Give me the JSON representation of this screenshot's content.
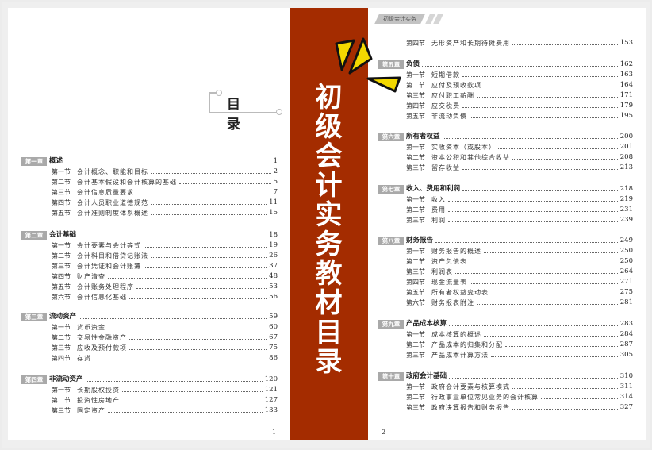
{
  "banner": {
    "chars": [
      "初",
      "级",
      "会",
      "计",
      "实",
      "务",
      "教",
      "材",
      "目",
      "录"
    ],
    "text": "初级会计实务教材目录",
    "color": "#a42c00"
  },
  "left_page": {
    "title": "目 录",
    "page_number": "1",
    "chapters": [
      {
        "badge": "第一章",
        "title": "概述",
        "page": "1",
        "sections": [
          {
            "label": "第一节",
            "title": "会计概念、职能和目标",
            "page": "2"
          },
          {
            "label": "第二节",
            "title": "会计基本假设和会计核算的基础",
            "page": "5"
          },
          {
            "label": "第三节",
            "title": "会计信息质量要求",
            "page": "7"
          },
          {
            "label": "第四节",
            "title": "会计人员职业道德规范",
            "page": "11"
          },
          {
            "label": "第五节",
            "title": "会计准则制度体系概述",
            "page": "15"
          }
        ]
      },
      {
        "badge": "第二章",
        "title": "会计基础",
        "page": "18",
        "sections": [
          {
            "label": "第一节",
            "title": "会计要素与会计等式",
            "page": "19"
          },
          {
            "label": "第二节",
            "title": "会计科目和借贷记账法",
            "page": "26"
          },
          {
            "label": "第三节",
            "title": "会计凭证和会计账簿",
            "page": "37"
          },
          {
            "label": "第四节",
            "title": "财产清查",
            "page": "48"
          },
          {
            "label": "第五节",
            "title": "会计账务处理程序",
            "page": "53"
          },
          {
            "label": "第六节",
            "title": "会计信息化基础",
            "page": "56"
          }
        ]
      },
      {
        "badge": "第三章",
        "title": "流动资产",
        "page": "59",
        "sections": [
          {
            "label": "第一节",
            "title": "货币资金",
            "page": "60"
          },
          {
            "label": "第二节",
            "title": "交易性金融资产",
            "page": "67"
          },
          {
            "label": "第三节",
            "title": "应收及预付款项",
            "page": "75"
          },
          {
            "label": "第四节",
            "title": "存货",
            "page": "86"
          }
        ]
      },
      {
        "badge": "第四章",
        "title": "非流动资产",
        "page": "120",
        "sections": [
          {
            "label": "第一节",
            "title": "长期股权投资",
            "page": "121"
          },
          {
            "label": "第二节",
            "title": "投资性房地产",
            "page": "127"
          },
          {
            "label": "第三节",
            "title": "固定资产",
            "page": "133"
          }
        ]
      }
    ]
  },
  "right_page": {
    "header": "初级会计实务",
    "page_number": "2",
    "continued_section": {
      "label": "第四节",
      "title": "无形资产和长期待摊费用",
      "page": "153"
    },
    "chapters": [
      {
        "badge": "第五章",
        "title": "负债",
        "page": "162",
        "sections": [
          {
            "label": "第一节",
            "title": "短期借款",
            "page": "163"
          },
          {
            "label": "第二节",
            "title": "应付及预收款项",
            "page": "164"
          },
          {
            "label": "第三节",
            "title": "应付职工薪酬",
            "page": "171"
          },
          {
            "label": "第四节",
            "title": "应交税费",
            "page": "179"
          },
          {
            "label": "第五节",
            "title": "非流动负债",
            "page": "195"
          }
        ]
      },
      {
        "badge": "第六章",
        "title": "所有者权益",
        "page": "200",
        "sections": [
          {
            "label": "第一节",
            "title": "实收资本（或股本）",
            "page": "201"
          },
          {
            "label": "第二节",
            "title": "资本公积和其他综合收益",
            "page": "208"
          },
          {
            "label": "第三节",
            "title": "留存收益",
            "page": "213"
          }
        ]
      },
      {
        "badge": "第七章",
        "title": "收入、费用和利润",
        "page": "218",
        "sections": [
          {
            "label": "第一节",
            "title": "收入",
            "page": "219"
          },
          {
            "label": "第二节",
            "title": "费用",
            "page": "231"
          },
          {
            "label": "第三节",
            "title": "利润",
            "page": "239"
          }
        ]
      },
      {
        "badge": "第八章",
        "title": "财务报告",
        "page": "249",
        "sections": [
          {
            "label": "第一节",
            "title": "财务报告的概述",
            "page": "250"
          },
          {
            "label": "第二节",
            "title": "资产负债表",
            "page": "250"
          },
          {
            "label": "第三节",
            "title": "利润表",
            "page": "264"
          },
          {
            "label": "第四节",
            "title": "现金流量表",
            "page": "271"
          },
          {
            "label": "第五节",
            "title": "所有者权益变动表",
            "page": "275"
          },
          {
            "label": "第六节",
            "title": "财务报表附注",
            "page": "281"
          }
        ]
      },
      {
        "badge": "第九章",
        "title": "产品成本核算",
        "page": "283",
        "sections": [
          {
            "label": "第一节",
            "title": "成本核算的概述",
            "page": "284"
          },
          {
            "label": "第二节",
            "title": "产品成本的归集和分配",
            "page": "287"
          },
          {
            "label": "第三节",
            "title": "产品成本计算方法",
            "page": "305"
          }
        ]
      },
      {
        "badge": "第十章",
        "title": "政府会计基础",
        "page": "310",
        "sections": [
          {
            "label": "第一节",
            "title": "政府会计要素与核算模式",
            "page": "311"
          },
          {
            "label": "第二节",
            "title": "行政事业单位常见业务的会计核算",
            "page": "314"
          },
          {
            "label": "第三节",
            "title": "政府决算报告和财务报告",
            "page": "327"
          }
        ]
      }
    ]
  }
}
